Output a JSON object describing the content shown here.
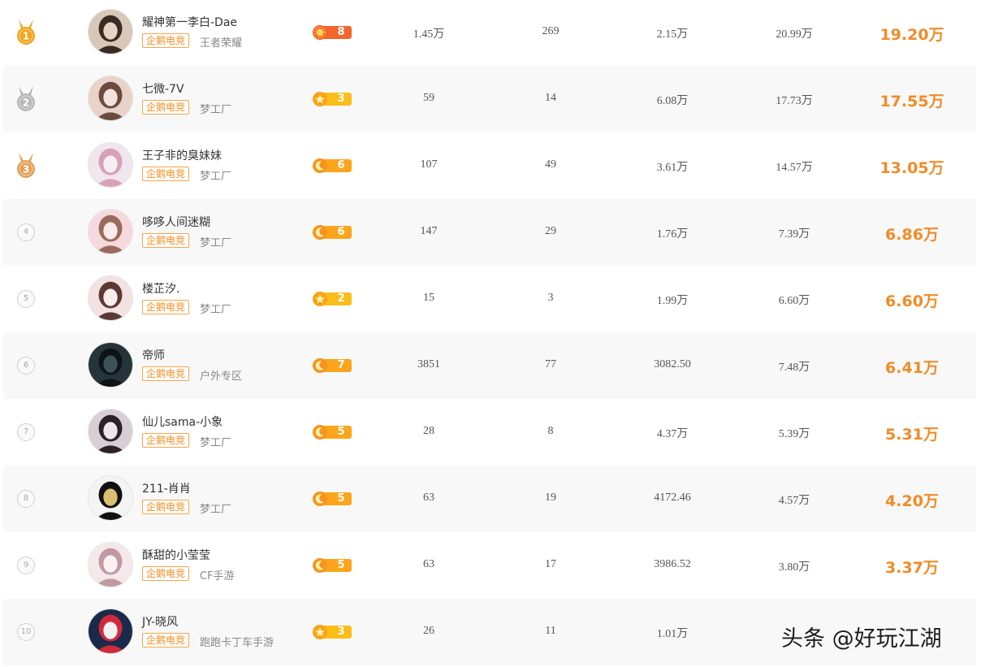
{
  "colors": {
    "accent_orange": "#f28b25",
    "guild_border": "#f6a64a",
    "row_alt_bg": "#f8f8f8",
    "medal_gold": "#f4a51c",
    "medal_silver": "#b9b9b9",
    "medal_bronze": "#e2a25a"
  },
  "rows": [
    {
      "rank": "1",
      "medal": "gold",
      "name": "耀神第一李白-Dae",
      "guild": "企鹅电竞",
      "category": "王者荣耀",
      "badge_icon": "sun-badge-icon",
      "badge_level": "8",
      "col1": "1.45万",
      "col2": "269",
      "col3": "2.15万",
      "col4": "20.99万",
      "total": "19.20万"
    },
    {
      "rank": "2",
      "medal": "silver",
      "name": "七微-7V",
      "guild": "企鹅电竞",
      "category": "梦工厂",
      "badge_icon": "star-badge-icon",
      "badge_level": "3",
      "col1": "59",
      "col2": "14",
      "col3": "6.08万",
      "col4": "17.73万",
      "total": "17.55万"
    },
    {
      "rank": "3",
      "medal": "bronze",
      "name": "王子非的臭妹妹",
      "guild": "企鹅电竞",
      "category": "梦工厂",
      "badge_icon": "moon-badge-icon",
      "badge_level": "6",
      "col1": "107",
      "col2": "49",
      "col3": "3.61万",
      "col4": "14.57万",
      "total": "13.05万"
    },
    {
      "rank": "4",
      "medal": "",
      "name": "哆哆人间迷糊",
      "guild": "企鹅电竞",
      "category": "梦工厂",
      "badge_icon": "moon-badge-icon",
      "badge_level": "6",
      "col1": "147",
      "col2": "29",
      "col3": "1.76万",
      "col4": "7.39万",
      "total": "6.86万"
    },
    {
      "rank": "5",
      "medal": "",
      "name": "楼芷汐.",
      "guild": "企鹅电竞",
      "category": "梦工厂",
      "badge_icon": "star-badge-icon",
      "badge_level": "2",
      "col1": "15",
      "col2": "3",
      "col3": "1.99万",
      "col4": "6.60万",
      "total": "6.60万"
    },
    {
      "rank": "6",
      "medal": "",
      "name": "帝师",
      "guild": "企鹅电竞",
      "category": "户外专区",
      "badge_icon": "moon-badge-icon",
      "badge_level": "7",
      "col1": "3851",
      "col2": "77",
      "col3": "3082.50",
      "col4": "7.48万",
      "total": "6.41万"
    },
    {
      "rank": "7",
      "medal": "",
      "name": "仙儿sama-小象",
      "guild": "企鹅电竞",
      "category": "梦工厂",
      "badge_icon": "moon-badge-icon",
      "badge_level": "5",
      "col1": "28",
      "col2": "8",
      "col3": "4.37万",
      "col4": "5.39万",
      "total": "5.31万"
    },
    {
      "rank": "8",
      "medal": "",
      "name": "211-肖肖",
      "guild": "企鹅电竞",
      "category": "梦工厂",
      "badge_icon": "moon-badge-icon",
      "badge_level": "5",
      "col1": "63",
      "col2": "19",
      "col3": "4172.46",
      "col4": "4.57万",
      "total": "4.20万"
    },
    {
      "rank": "9",
      "medal": "",
      "name": "酥甜的小莹莹",
      "guild": "企鹅电竞",
      "category": "CF手游",
      "badge_icon": "moon-badge-icon",
      "badge_level": "5",
      "col1": "63",
      "col2": "17",
      "col3": "3986.52",
      "col4": "3.80万",
      "total": "3.37万"
    },
    {
      "rank": "10",
      "medal": "",
      "name": "JY-晓风",
      "guild": "企鹅电竞",
      "category": "跑跑卡丁车手游",
      "badge_icon": "star-badge-icon",
      "badge_level": "3",
      "col1": "26",
      "col2": "11",
      "col3": "1.01万",
      "col4": "",
      "total": ""
    }
  ],
  "watermark": "头条 @好玩江湖"
}
